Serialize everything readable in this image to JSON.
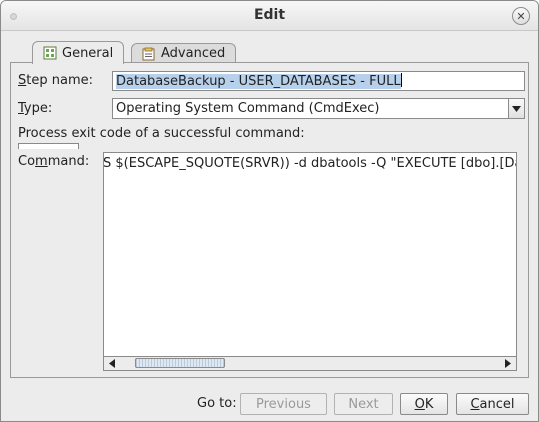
{
  "window": {
    "title": "Edit"
  },
  "tabs": [
    {
      "label": "General",
      "icon": "general-icon",
      "active": true
    },
    {
      "label": "Advanced",
      "icon": "advanced-icon",
      "active": false
    }
  ],
  "form": {
    "step_name": {
      "label_ul": "S",
      "label_rest": "tep name:",
      "value": "DatabaseBackup - USER_DATABASES - FULL"
    },
    "type": {
      "label_ul": "T",
      "label_rest": "ype:",
      "value": "Operating System Command (CmdExec)"
    },
    "exit_code": {
      "label": "Process exit code of a successful command:"
    },
    "command": {
      "label_pre": "Co",
      "label_ul": "m",
      "label_rest": "mand:",
      "value": "S $(ESCAPE_SQUOTE(SRVR)) -d dbatools -Q \"EXECUTE [dbo].[DatabaseBackup]"
    }
  },
  "footer": {
    "goto_label": "Go to:",
    "previous": "Previous",
    "next": "Next",
    "ok_ul": "O",
    "ok_rest": "K",
    "cancel_ul": "C",
    "cancel_rest": "ancel"
  }
}
